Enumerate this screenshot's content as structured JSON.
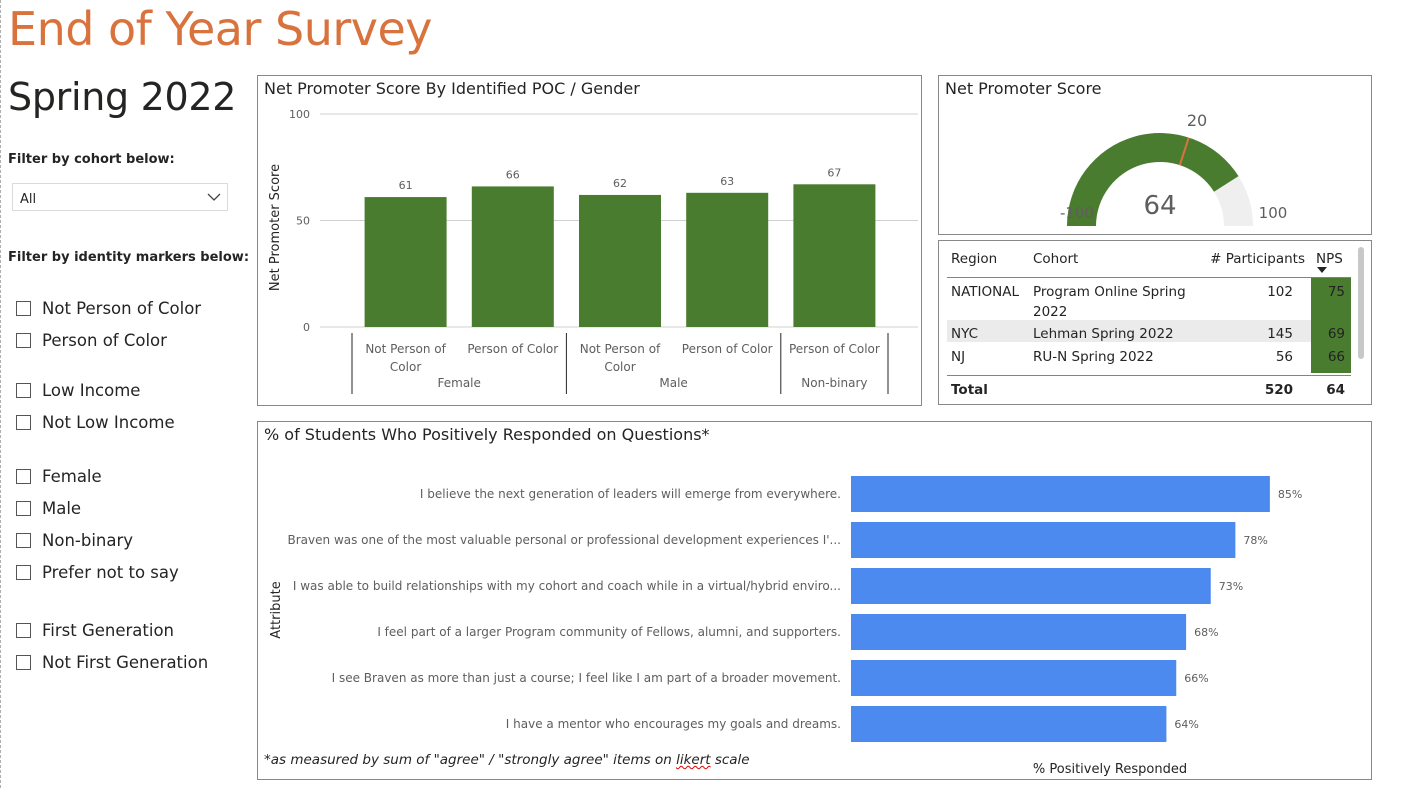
{
  "header": {
    "title": "End of Year Survey",
    "subtitle": "Spring 2022"
  },
  "filters": {
    "cohort_label": "Filter by cohort below:",
    "cohort_value": "All",
    "identity_label": "Filter by identity markers below:",
    "options": [
      "Not Person of Color",
      "Person of Color",
      "Low Income",
      "Not Low Income",
      "Female",
      "Male",
      "Non-binary",
      "Prefer not to say",
      "First Generation",
      "Not First Generation"
    ]
  },
  "nps_by_group": {
    "title": "Net Promoter Score By Identified POC / Gender",
    "chart_data": {
      "type": "bar",
      "ylabel": "Net Promoter Score",
      "ylim": [
        0,
        100
      ],
      "yticks": [
        "0",
        "50",
        "100"
      ],
      "categories": [
        "Not Person of Color",
        "Person of Color",
        "Not Person of Color",
        "Person of Color",
        "Person of Color"
      ],
      "groups": [
        "Female",
        "Male",
        "Non-binary"
      ],
      "group_of": [
        "Female",
        "Female",
        "Male",
        "Male",
        "Non-binary"
      ],
      "values": [
        61,
        66,
        62,
        63,
        67
      ],
      "color": "#4a7c2f"
    }
  },
  "nps_gauge": {
    "title": "Net Promoter Score",
    "value": "64",
    "value_num": 64,
    "min": "-100",
    "max": "100",
    "target": "20",
    "target_num": 20,
    "color": "#4a7c2f",
    "target_color": "#d9733d"
  },
  "region_table": {
    "headers": {
      "region": "Region",
      "cohort": "Cohort",
      "participants": "# Participants",
      "nps": "NPS"
    },
    "rows": [
      {
        "region": "NATIONAL",
        "cohort_line1": "Program Online Spring",
        "cohort_line2": "2022",
        "participants": "102",
        "nps": "75"
      },
      {
        "region": "NYC",
        "cohort_line1": "Lehman Spring 2022",
        "cohort_line2": "",
        "participants": "145",
        "nps": "69"
      },
      {
        "region": "NJ",
        "cohort_line1": "RU-N Spring 2022",
        "cohort_line2": "",
        "participants": "56",
        "nps": "66"
      }
    ],
    "total": {
      "label": "Total",
      "participants": "520",
      "nps": "64"
    }
  },
  "questions_chart": {
    "title": "% of Students Who Positively Responded on Questions*",
    "footnote_pre": "*as measured by sum of \"agree\" / \"strongly agree\" items on ",
    "footnote_word": "likert",
    "footnote_post": " scale",
    "chart_data": {
      "type": "bar",
      "orientation": "horizontal",
      "ylabel": "Attribute",
      "xlabel": "% Positively Responded",
      "categories": [
        "I believe the next generation of leaders will emerge from everywhere.",
        "Braven was one of the most valuable personal or professional development experiences I'...",
        "I was able to build relationships with my cohort and coach while in a virtual/hybrid enviro...",
        "I feel part of a larger Program community of Fellows, alumni, and supporters.",
        "I see Braven as more than just a course; I feel like I am part of a broader movement.",
        "I have a mentor who encourages my goals and dreams."
      ],
      "values": [
        85,
        78,
        73,
        68,
        66,
        64
      ],
      "labels": [
        "85%",
        "78%",
        "73%",
        "68%",
        "66%",
        "64%"
      ],
      "color": "#4d8af0"
    }
  }
}
